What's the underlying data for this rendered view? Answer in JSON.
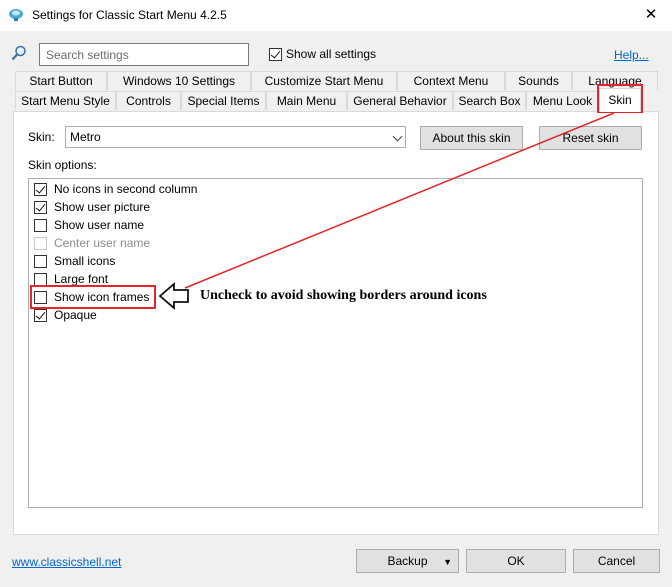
{
  "window": {
    "title": "Settings for Classic Start Menu 4.2.5",
    "icon": "shell-app-icon"
  },
  "top": {
    "search_placeholder": "Search settings",
    "show_all_label": "Show all settings",
    "show_all_checked": true,
    "help_label": "Help..."
  },
  "tabs_row1": [
    {
      "label": "Start Button"
    },
    {
      "label": "Windows 10 Settings"
    },
    {
      "label": "Customize Start Menu"
    },
    {
      "label": "Context Menu"
    },
    {
      "label": "Sounds"
    },
    {
      "label": "Language"
    }
  ],
  "tabs_row2": [
    {
      "label": "Start Menu Style"
    },
    {
      "label": "Controls"
    },
    {
      "label": "Special Items"
    },
    {
      "label": "Main Menu"
    },
    {
      "label": "General Behavior"
    },
    {
      "label": "Search Box"
    },
    {
      "label": "Menu Look"
    },
    {
      "label": "Skin",
      "active": true
    }
  ],
  "skin": {
    "label": "Skin:",
    "selected": "Metro",
    "about_label": "About this skin",
    "reset_label": "Reset skin",
    "options_label": "Skin options:"
  },
  "options": [
    {
      "label": "No icons in second column",
      "checked": true,
      "disabled": false
    },
    {
      "label": "Show user picture",
      "checked": true,
      "disabled": false
    },
    {
      "label": "Show user name",
      "checked": false,
      "disabled": false
    },
    {
      "label": "Center user name",
      "checked": false,
      "disabled": true
    },
    {
      "label": "Small icons",
      "checked": false,
      "disabled": false
    },
    {
      "label": "Large font",
      "checked": false,
      "disabled": false
    },
    {
      "label": "Show icon frames",
      "checked": false,
      "disabled": false
    },
    {
      "label": "Opaque",
      "checked": true,
      "disabled": false
    }
  ],
  "annotation": {
    "text": "Uncheck to avoid showing borders around icons",
    "color": "#e3262a"
  },
  "footer": {
    "site_link": "www.classicshell.net",
    "backup_label": "Backup",
    "ok_label": "OK",
    "cancel_label": "Cancel"
  }
}
